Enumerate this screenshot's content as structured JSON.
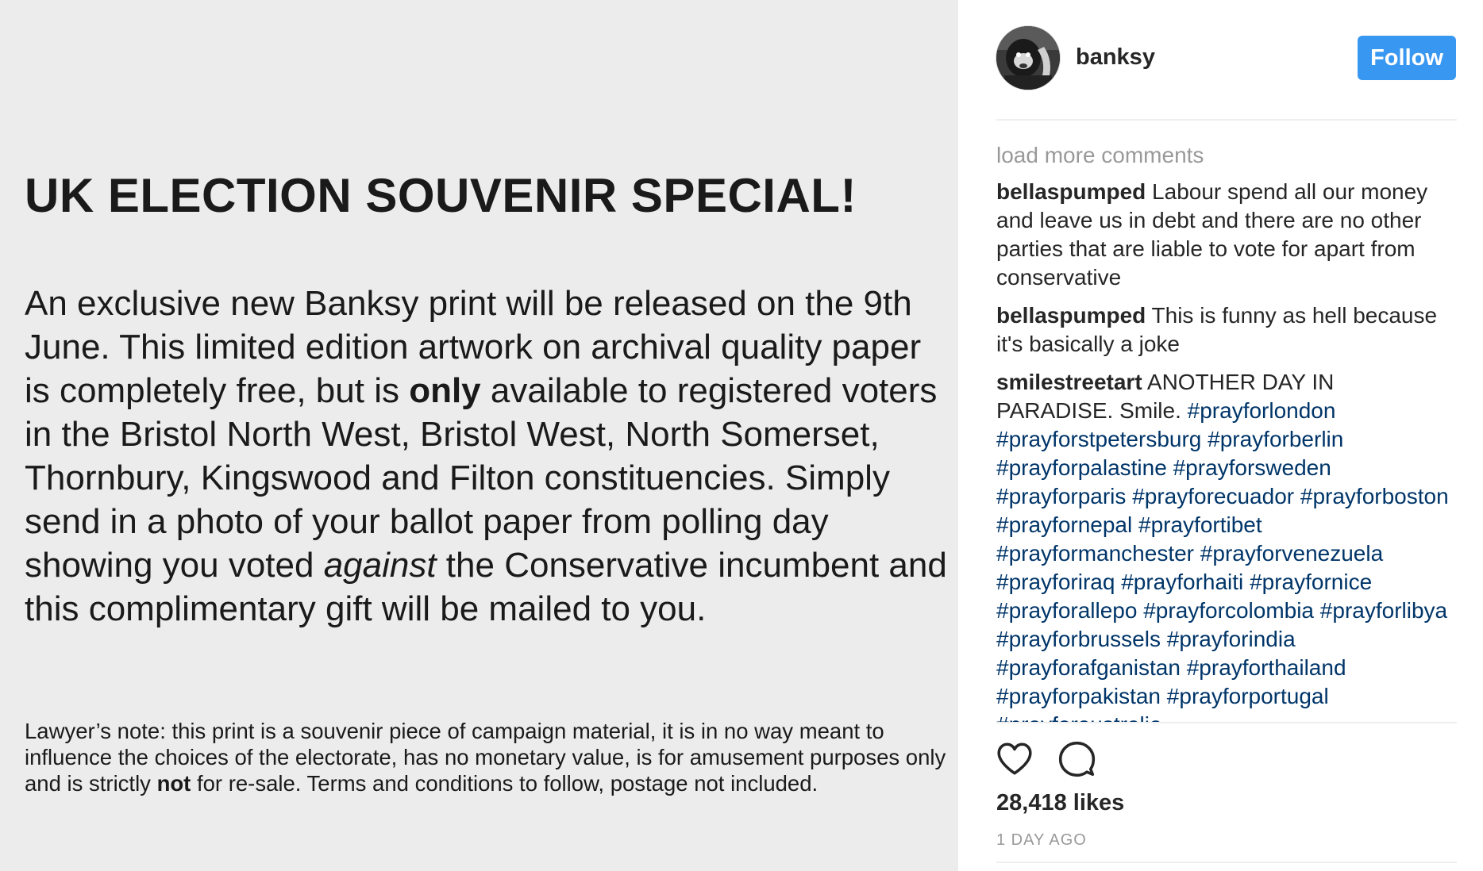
{
  "post": {
    "title": "UK ELECTION SOUVENIR SPECIAL!",
    "body": {
      "p1": "An exclusive new Banksy print will be released on the 9th June. This limited edition artwork on archival quality paper is completely free, but is ",
      "bold_only": "only",
      "p2": " available to registered voters in the Bristol North West, Bristol West, North Somerset, Thornbury, Kingswood and Filton constituencies. Simply send in a photo of your ballot paper from polling day showing you voted ",
      "italic_against": "against",
      "p3": " the Conservative incumbent and this complimentary gift will be mailed to you."
    },
    "lawyer_note": {
      "part1": "Lawyer’s note: this print is a souvenir piece of campaign material, it is in no way meant to influence the choices of the electorate, has no monetary value, is for amusement purposes only and is strictly ",
      "bold_not": "not",
      "part2": " for re-sale. Terms and conditions to follow, postage not included."
    }
  },
  "header": {
    "username": "banksy",
    "follow_label": "Follow",
    "follow_color": "#3897f0"
  },
  "comments": {
    "load_more": "load more comments",
    "items": [
      {
        "user": "bellaspumped",
        "text": " Labour spend all our money and leave us in debt and there are no other parties that are liable to vote for apart from conservative"
      },
      {
        "user": "bellaspumped",
        "text": " This is funny as hell because it's basically a joke"
      },
      {
        "user": "smilestreetart",
        "text": " ANOTHER DAY IN PARADISE. Smile. "
      }
    ],
    "hashtags": [
      "#prayforlondon",
      "#prayforstpetersburg",
      "#prayforberlin",
      "#prayforpalastine",
      "#prayforsweden",
      "#prayforparis",
      "#prayforecuador",
      "#prayforboston",
      "#prayfornepal",
      "#prayfortibet",
      "#prayformanchester",
      "#prayforvenezuela",
      "#prayforiraq",
      "#prayforhaiti",
      "#prayfornice",
      "#prayforallepo",
      "#prayforcolombia",
      "#prayforlibya",
      "#prayforbrussels",
      "#prayforindia",
      "#prayforafganistan",
      "#prayforthailand",
      "#prayforpakistan",
      "#prayforportugal",
      "#prayforaustralia"
    ],
    "hashtag_color": "#003569"
  },
  "actions": {
    "like_icon": "heart-icon",
    "comment_icon": "speech-bubble-icon"
  },
  "stats": {
    "likes": "28,418 likes",
    "time_ago": "1 DAY AGO"
  }
}
